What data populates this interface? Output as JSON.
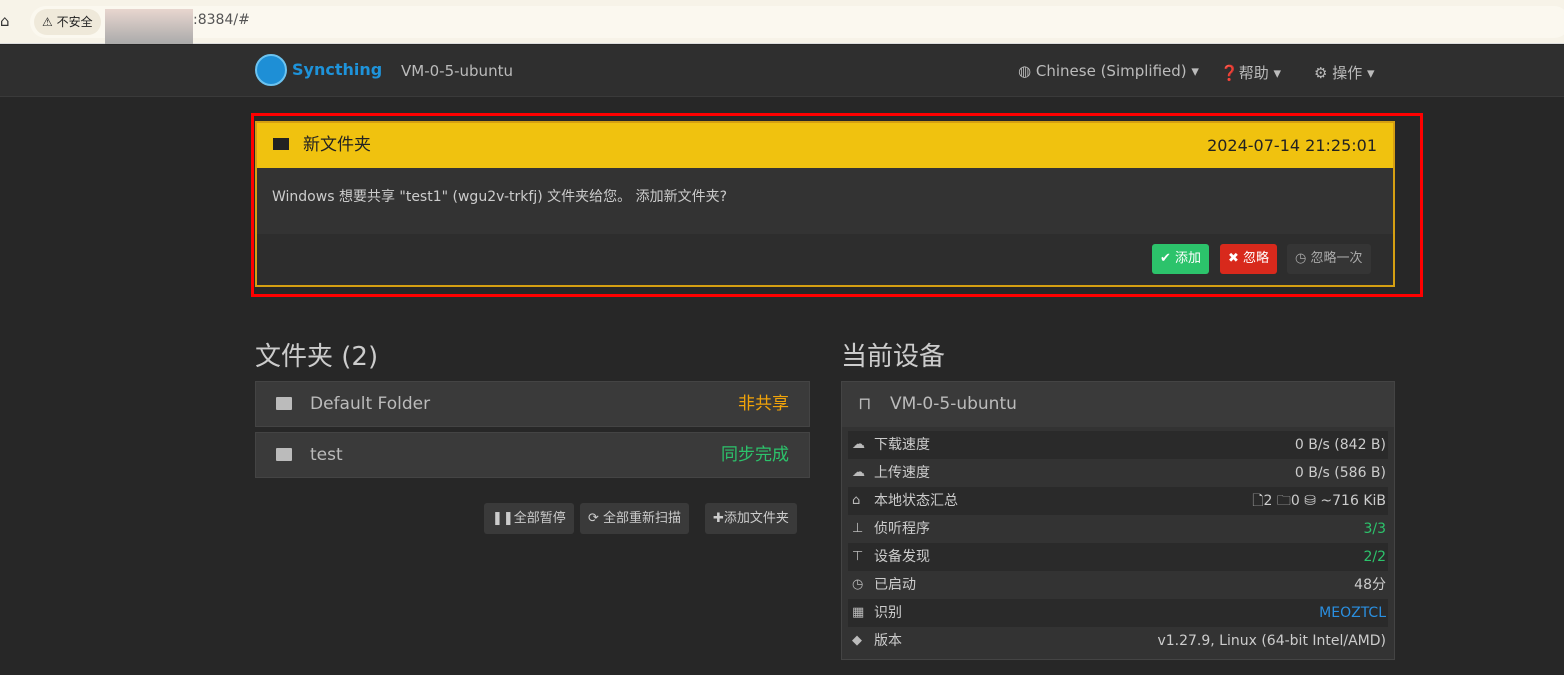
{
  "browser": {
    "security_label": "不安全",
    "url": ":8384/#"
  },
  "navbar": {
    "brand": "Syncthing",
    "hostname": "VM-0-5-ubuntu",
    "language": "Chinese (Simplified)",
    "help": "帮助",
    "actions": "操作"
  },
  "alert": {
    "title": "新文件夹",
    "timestamp": "2024-07-14 21:25:01",
    "message": "Windows 想要共享 \"test1\" (wgu2v-trkfj) 文件夹给您。 添加新文件夹?",
    "add": "添加",
    "ignore": "忽略",
    "dismiss": "忽略一次"
  },
  "folders": {
    "title": "文件夹 (2)",
    "items": [
      {
        "name": "Default Folder",
        "status": "非共享",
        "color": "#f0a30a"
      },
      {
        "name": "test",
        "status": "同步完成",
        "color": "#2cc36b"
      }
    ],
    "pause_all": "全部暂停",
    "rescan_all": "全部重新扫描",
    "add_folder": "添加文件夹"
  },
  "device": {
    "title": "当前设备",
    "name": "VM-0-5-ubuntu",
    "rows": [
      {
        "label": "下载速度",
        "value": "0 B/s (842 B)"
      },
      {
        "label": "上传速度",
        "value": "0 B/s (586 B)"
      },
      {
        "label": "本地状态汇总",
        "files": "2",
        "dirs": "0",
        "size": "~716 KiB"
      },
      {
        "label": "侦听程序",
        "value": "3/3"
      },
      {
        "label": "设备发现",
        "value": "2/2"
      },
      {
        "label": "已启动",
        "value": "48分"
      },
      {
        "label": "识别",
        "value": "MEOZTCL"
      },
      {
        "label": "版本",
        "value": "v1.27.9, Linux (64-bit Intel/AMD)"
      }
    ]
  }
}
